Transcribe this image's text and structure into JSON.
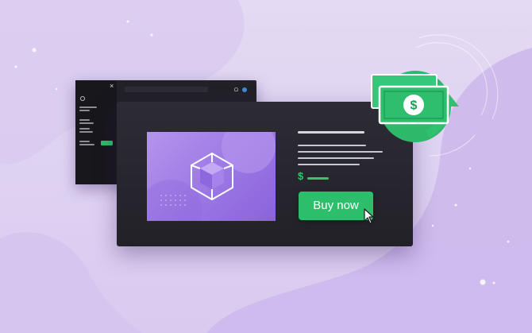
{
  "product": {
    "buy_button_label": "Buy now",
    "price_symbol": "$"
  },
  "money_badge": {
    "symbol": "$",
    "icon": "money-refund-icon"
  },
  "back_window": {
    "close_symbol": "×"
  },
  "colors": {
    "accent_green": "#2dbe6c",
    "product_purple": "#9b77e3",
    "window_dark": "#222128",
    "background": "#e7def5"
  }
}
